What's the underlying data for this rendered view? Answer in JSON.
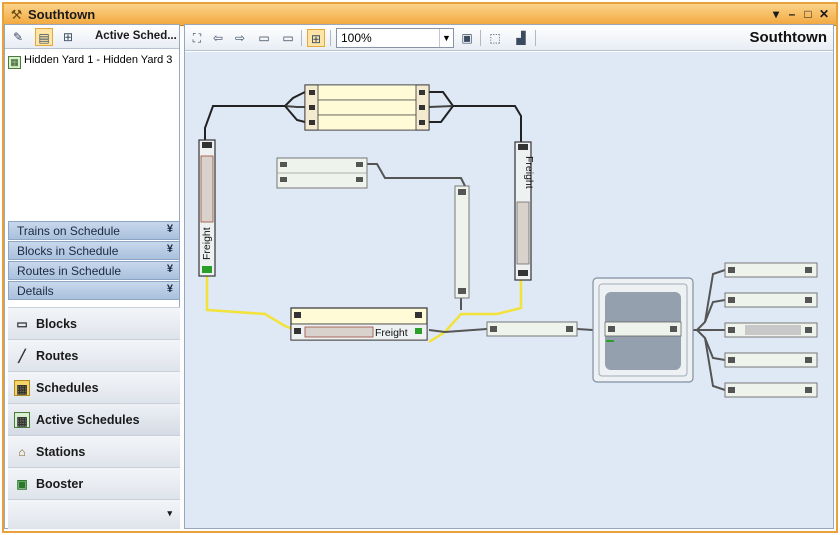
{
  "window": {
    "title": "Southtown"
  },
  "left": {
    "heading": "Active Sched...",
    "list": [
      {
        "label": "Hidden Yard 1 - Hidden Yard 3"
      }
    ],
    "sections": [
      {
        "label": "Trains on Schedule"
      },
      {
        "label": "Blocks in Schedule"
      },
      {
        "label": "Routes in Schedule"
      },
      {
        "label": "Details"
      }
    ],
    "nav": [
      {
        "label": "Blocks",
        "icon": "blocks-icon"
      },
      {
        "label": "Routes",
        "icon": "routes-icon"
      },
      {
        "label": "Schedules",
        "icon": "schedules-icon"
      },
      {
        "label": "Active Schedules",
        "icon": "active-schedules-icon"
      },
      {
        "label": "Stations",
        "icon": "stations-icon"
      },
      {
        "label": "Booster",
        "icon": "booster-icon"
      }
    ]
  },
  "toolbar": {
    "zoom": "100%",
    "station": "Southtown"
  },
  "layout": {
    "train_labels": {
      "left_vertical": "Freight",
      "right_vertical": "Freight",
      "bottom": "Freight"
    }
  },
  "colors": {
    "accent": "#f2a83e",
    "canvas": "#dfe9f5",
    "track_active": "#f2e23a",
    "block_reserved": "#fffbd6",
    "block_free": "#eef3ec"
  }
}
